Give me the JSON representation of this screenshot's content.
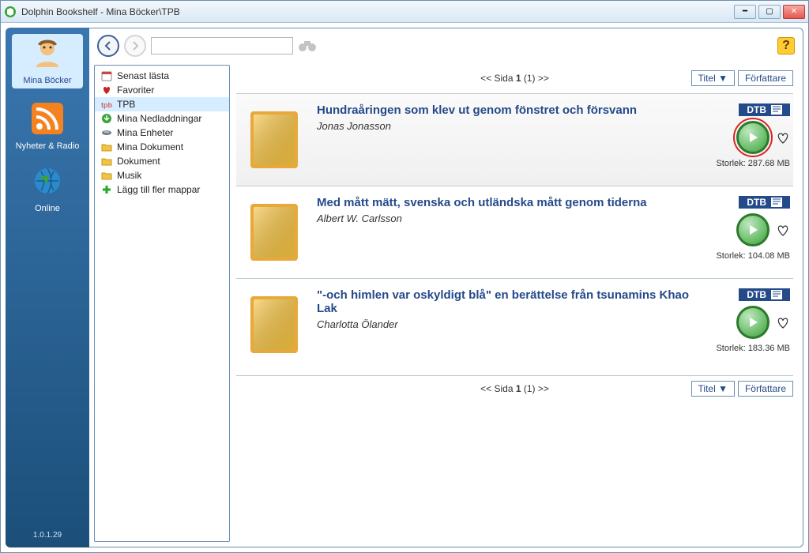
{
  "window": {
    "title": "Dolphin Bookshelf - Mina Böcker\\TPB",
    "version": "1.0.1.29"
  },
  "sidebar": {
    "items": [
      {
        "label": "Mina Böcker"
      },
      {
        "label": "Nyheter & Radio"
      },
      {
        "label": "Online"
      }
    ]
  },
  "tree": {
    "items": [
      {
        "label": "Senast lästa",
        "icon": "calendar"
      },
      {
        "label": "Favoriter",
        "icon": "heart"
      },
      {
        "label": "TPB",
        "icon": "tpb",
        "selected": true
      },
      {
        "label": "Mina Nedladdningar",
        "icon": "download"
      },
      {
        "label": "Mina Enheter",
        "icon": "device"
      },
      {
        "label": "Mina Dokument",
        "icon": "folder"
      },
      {
        "label": "Dokument",
        "icon": "folder"
      },
      {
        "label": "Musik",
        "icon": "folder"
      },
      {
        "label": "Lägg till fler mappar",
        "icon": "plus"
      }
    ]
  },
  "pager": {
    "prefix": "<< Sida ",
    "page": "1",
    "total": " (1) >>"
  },
  "sort": {
    "title": "Titel ▼",
    "author": "Författare"
  },
  "books": [
    {
      "title": "Hundraåringen som klev ut genom fönstret och försvann",
      "author": "Jonas Jonasson",
      "badge": "DTB",
      "size": "Storlek: 287.68 MB",
      "highlight": true
    },
    {
      "title": "Med mått mätt, svenska och utländska mått genom tiderna",
      "author": "Albert W. Carlsson",
      "badge": "DTB",
      "size": "Storlek: 104.08 MB"
    },
    {
      "title": "\"-och himlen var oskyldigt blå\" en berättelse från tsunamins Khao Lak",
      "author": "Charlotta Ölander",
      "badge": "DTB",
      "size": "Storlek: 183.36 MB"
    }
  ],
  "help": "?"
}
